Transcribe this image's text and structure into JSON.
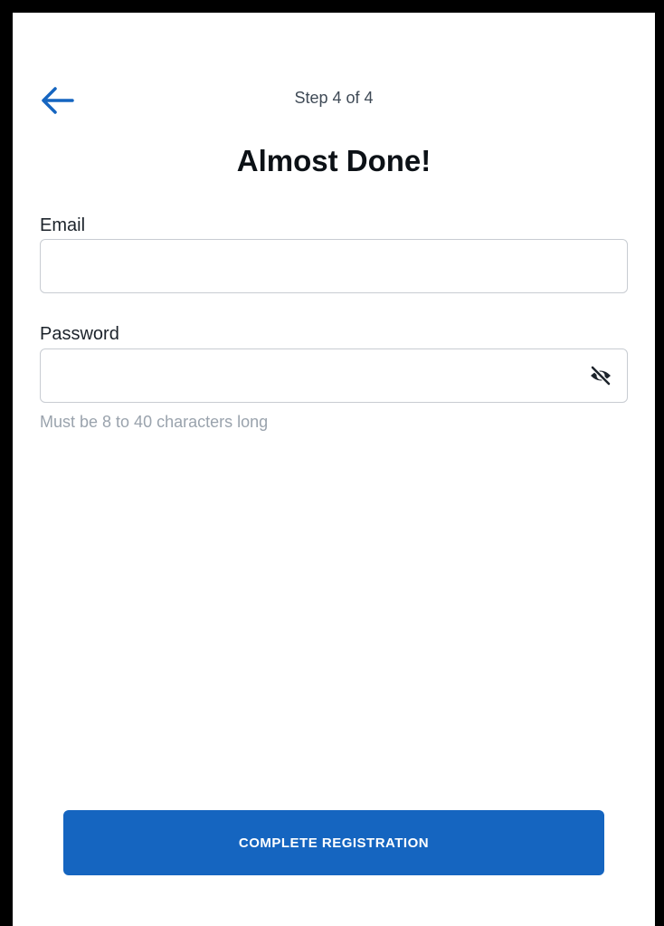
{
  "header": {
    "step_label": "Step 4 of 4",
    "back_icon": "arrow-left-icon"
  },
  "title": "Almost Done!",
  "form": {
    "email": {
      "label": "Email",
      "value": "",
      "placeholder": ""
    },
    "password": {
      "label": "Password",
      "value": "",
      "placeholder": "",
      "toggle_icon": "eye-slash-icon",
      "helper": "Must be 8 to 40 characters long"
    }
  },
  "submit": {
    "label": "COMPLETE REGISTRATION"
  },
  "colors": {
    "accent": "#1565c0",
    "title_text": "#0c1116",
    "helper_text": "#9aa3ad",
    "border": "#c8ccd2"
  }
}
